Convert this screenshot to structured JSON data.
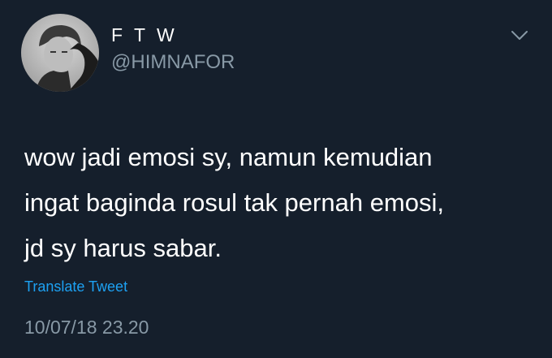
{
  "tweet": {
    "display_name": "F T W",
    "handle": "@HIMNAFOR",
    "text_lines": [
      "wow jadi emosi sy, namun kemudian",
      "ingat baginda rosul tak pernah emosi,",
      "jd sy harus sabar."
    ],
    "translate_label": "Translate Tweet",
    "timestamp": "10/07/18 23.20",
    "avatar_icon": "profile-photo",
    "menu_icon": "chevron-down-icon"
  },
  "colors": {
    "background": "#151f2c",
    "text": "#ffffff",
    "secondary_text": "#8899a6",
    "link": "#1da1f2"
  }
}
